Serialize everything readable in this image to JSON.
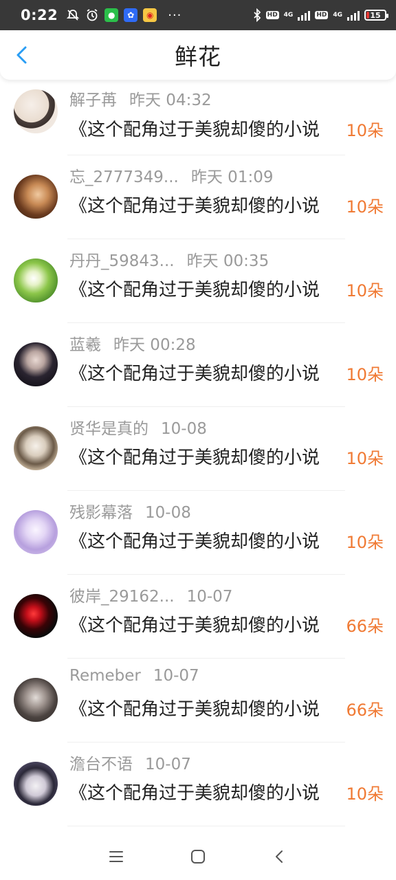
{
  "status_bar": {
    "time": "0:22",
    "battery": "15",
    "net1": "4G",
    "net2": "4G",
    "hd": "HD",
    "more": "···"
  },
  "header": {
    "title": "鲜花"
  },
  "items": [
    {
      "name": "解子苒",
      "time": "昨天 04:32",
      "content": "《这个配角过于美貌却傻的小说",
      "amount": "10朵"
    },
    {
      "name": "忘_2777349...",
      "time": "昨天 01:09",
      "content": "《这个配角过于美貌却傻的小说",
      "amount": "10朵"
    },
    {
      "name": "丹丹_59843...",
      "time": "昨天 00:35",
      "content": "《这个配角过于美貌却傻的小说",
      "amount": "10朵"
    },
    {
      "name": "蓝羲",
      "time": "昨天 00:28",
      "content": "《这个配角过于美貌却傻的小说",
      "amount": "10朵"
    },
    {
      "name": "贤华是真的",
      "time": "10-08",
      "content": "《这个配角过于美貌却傻的小说",
      "amount": "10朵"
    },
    {
      "name": "残影幕落",
      "time": "10-08",
      "content": "《这个配角过于美貌却傻的小说",
      "amount": "10朵"
    },
    {
      "name": "彼岸_29162...",
      "time": "10-07",
      "content": "《这个配角过于美貌却傻的小说",
      "amount": "66朵"
    },
    {
      "name": "Remeber",
      "time": "10-07",
      "content": "《这个配角过于美貌却傻的小说",
      "amount": "66朵"
    },
    {
      "name": "澹台不语",
      "time": "10-07",
      "content": "《这个配角过于美貌却傻的小说",
      "amount": "10朵"
    }
  ],
  "colors": {
    "accent": "#2a9df4",
    "amount": "#f07a34",
    "meta": "#9a9a9a",
    "status_bar": "#383838",
    "battery_low": "#e53935"
  }
}
